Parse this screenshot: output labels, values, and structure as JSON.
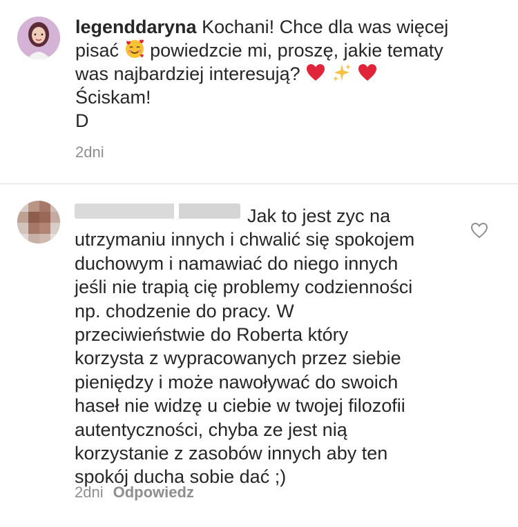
{
  "caption": {
    "username": "legenddaryna",
    "line1": "Kochani! Chce dla was więcej",
    "line2a": "pisać",
    "line2b": "powiedzcie mi, proszę, jakie tematy",
    "line3": "was najbardziej interesują?",
    "line4": "Ściskam!",
    "line5": "D",
    "time": "2dni",
    "emoji_1": "smiling-face-with-hearts",
    "emoji_2": "red-heart",
    "emoji_3": "sparkles",
    "emoji_4": "red-heart"
  },
  "comment": {
    "text": "Jak to jest zyc na\nutrzymaniu innych i chwalić się spokojem\nduchowym i namawiać do niego innych\njeśli nie trapią cię problemy codzienności\nnp. chodzenie do pracy. W\nprzeciwieństwie do Roberta który\nkorzysta z wypracowanych przez siebie\npieniędzy i może nawoływać do swoich\nhaseł nie widzę u ciebie w twojej filozofii\nautentyczności, chyba ze jest nią\nkorzystanie z zasobów innych aby ten\nspokój ducha sobie dać ;)",
    "time": "2dni",
    "reply_label": "Odpowiedz",
    "like_icon": "heart-outline-icon"
  },
  "colors": {
    "text": "#262626",
    "muted": "#8e8e8e",
    "divider": "#dbdbdb",
    "heart": "#e0243a"
  }
}
